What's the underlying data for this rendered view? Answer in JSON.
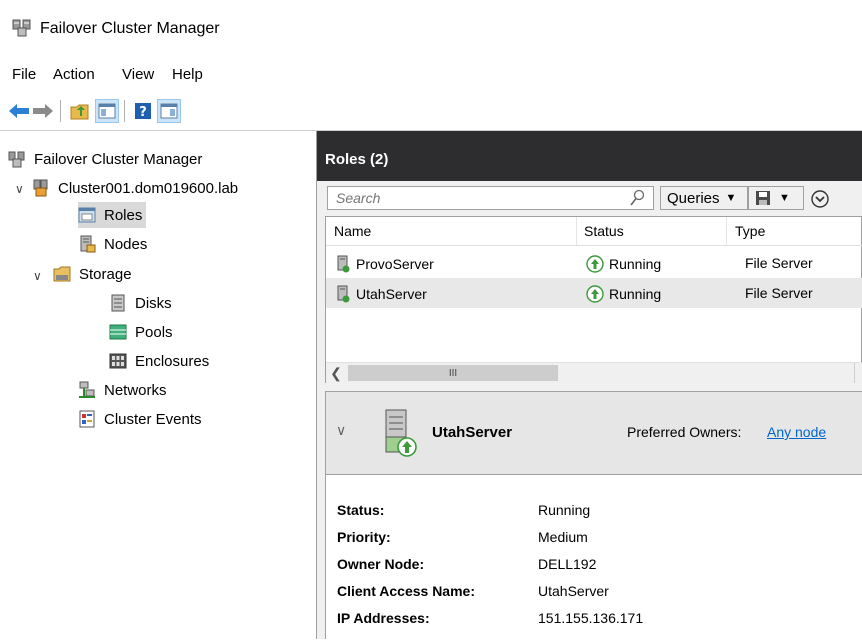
{
  "window": {
    "title": "Failover Cluster Manager"
  },
  "menu": [
    "File",
    "Action",
    "View",
    "Help"
  ],
  "toolbar": {
    "icons": [
      "back-arrow-icon",
      "forward-arrow-icon",
      "up-folder-icon",
      "show-hide-tree-icon",
      "help-icon",
      "show-hide-action-pane-icon"
    ]
  },
  "tree": {
    "root": "Failover Cluster Manager",
    "cluster": "Cluster001.dom019600.lab",
    "roles": "Roles",
    "nodes": "Nodes",
    "storage": "Storage",
    "disks": "Disks",
    "pools": "Pools",
    "enclosures": "Enclosures",
    "networks": "Networks",
    "events": "Cluster Events"
  },
  "roles_panel": {
    "title": "Roles (2)",
    "search_placeholder": "Search",
    "queries_label": "Queries",
    "columns": [
      "Name",
      "Status",
      "Type"
    ],
    "rows": [
      {
        "name": "ProvoServer",
        "status": "Running",
        "type": "File Server"
      },
      {
        "name": "UtahServer",
        "status": "Running",
        "type": "File Server"
      }
    ],
    "scroll_thumb": "III"
  },
  "details": {
    "name": "UtahServer",
    "preferred_owners_label": "Preferred Owners:",
    "preferred_owners_link": "Any node",
    "props": [
      {
        "label": "Status:",
        "value": "Running"
      },
      {
        "label": "Priority:",
        "value": "Medium"
      },
      {
        "label": "Owner Node:",
        "value": "DELL192"
      },
      {
        "label": "Client Access Name:",
        "value": "UtahServer"
      },
      {
        "label": "IP Addresses:",
        "value": "151.155.136.171"
      }
    ]
  },
  "colors": {
    "header_bg": "#2d2d30",
    "link": "#0066cc",
    "running_green": "#3c9a3c",
    "selection": "#d9d9d9"
  }
}
